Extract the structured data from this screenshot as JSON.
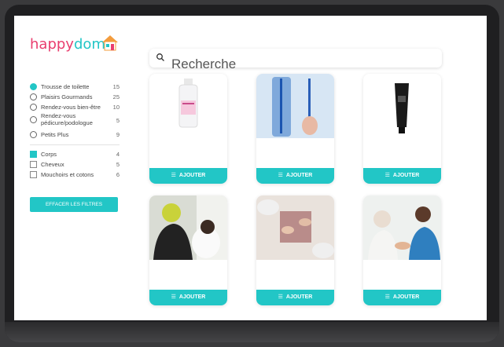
{
  "logo": {
    "part1": "happy",
    "part2": "dom"
  },
  "search": {
    "placeholder": "Recherche"
  },
  "filters": {
    "radios": [
      {
        "label": "Trousse de toilette",
        "count": "15",
        "selected": true
      },
      {
        "label": "Plaisirs Gourmands",
        "count": "25",
        "selected": false
      },
      {
        "label": "Rendez-vous bien-être",
        "count": "10",
        "selected": false
      },
      {
        "label": "Rendez-vous pédicure/podologue",
        "count": "5",
        "selected": false
      },
      {
        "label": "Petits Plus",
        "count": "9",
        "selected": false
      }
    ],
    "checks": [
      {
        "label": "Corps",
        "count": "4",
        "checked": true
      },
      {
        "label": "Cheveux",
        "count": "5",
        "checked": false
      },
      {
        "label": "Mouchoirs et cotons",
        "count": "6",
        "checked": false
      }
    ],
    "clear_label": "EFFACER LES FILTRES"
  },
  "products": [
    {
      "image": "lotion-bottle",
      "button": "AJOUTER"
    },
    {
      "image": "toothbrushes",
      "button": "AJOUTER"
    },
    {
      "image": "black-tube",
      "button": "AJOUTER"
    },
    {
      "image": "hairdresser",
      "button": "AJOUTER"
    },
    {
      "image": "hands-game",
      "button": "AJOUTER"
    },
    {
      "image": "caregiver-elderly",
      "button": "AJOUTER"
    }
  ],
  "colors": {
    "accent": "#22c6c6",
    "brand_pink": "#e93d6e"
  }
}
